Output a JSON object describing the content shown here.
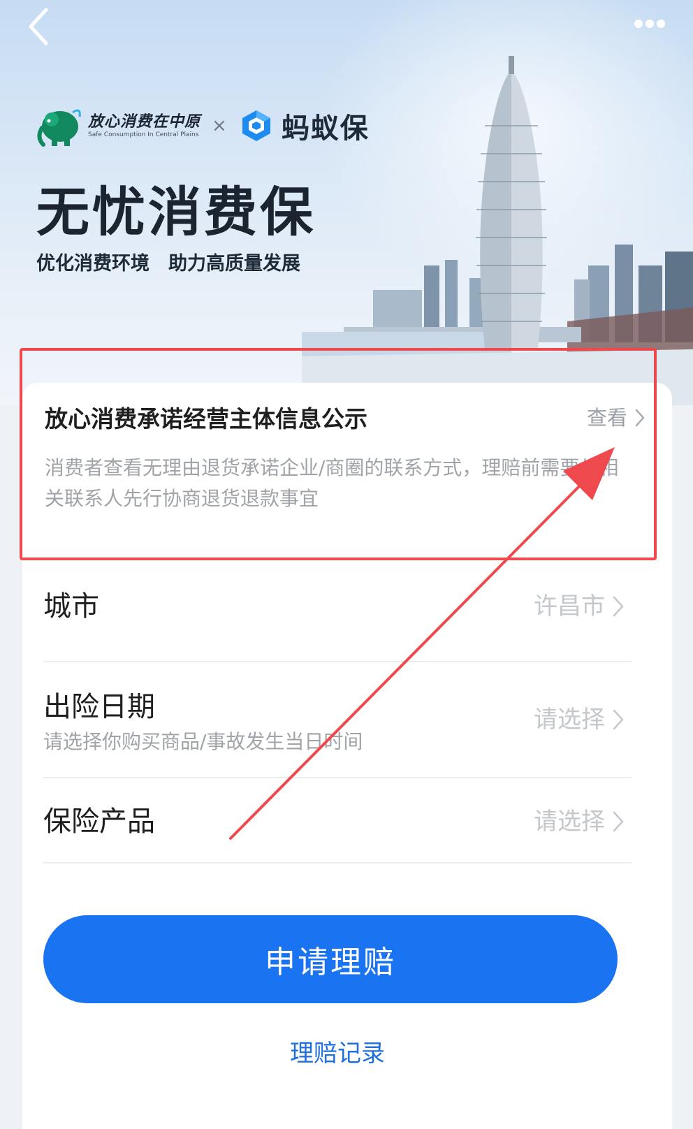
{
  "hero": {
    "brand1_name": "放心消费在中原",
    "brand1_subtitle": "Safe Consumption In Central Plains",
    "times_symbol": "×",
    "brand2_name": "蚂蚁保",
    "title": "无忧消费保",
    "subtitle": "优化消费环境　助力高质量发展"
  },
  "notice": {
    "title": "放心消费承诺经营主体信息公示",
    "link_label": "查看",
    "description": "消费者查看无理由退货承诺企业/商圈的联系方式，理赔前需要与相关联系人先行协商退货退款事宜"
  },
  "form": {
    "city": {
      "label": "城市",
      "value": "许昌市"
    },
    "date": {
      "label": "出险日期",
      "hint": "请选择你购买商品/事故发生当日时间",
      "value": "请选择"
    },
    "product": {
      "label": "保险产品",
      "value": "请选择"
    }
  },
  "actions": {
    "submit_label": "申请理赔",
    "records_label": "理赔记录"
  },
  "colors": {
    "primary": "#1a73f0",
    "link": "#1f6fdf",
    "annotation_red": "#ee4a4e",
    "brand_green": "#12885f",
    "brand_blue": "#1e8bf0"
  },
  "icons": {
    "back": "chevron-left-icon",
    "more": "more-dots-icon",
    "chevron": "chevron-right-icon",
    "elephant_logo": "elephant-logo-icon",
    "ant_logo": "ant-insurance-logo-icon"
  }
}
